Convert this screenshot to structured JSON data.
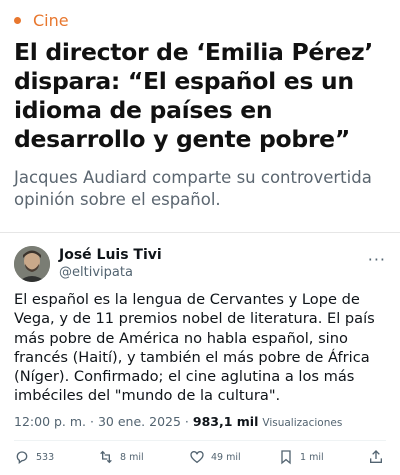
{
  "article": {
    "category": "Cine",
    "headline": "El director de ‘Emilia Pérez’ dispara: “El español es un idioma de países en desarrollo y gente pobre”",
    "subheadline": "Jacques Audiard comparte su controvertida opinión sobre el español."
  },
  "tweet": {
    "display_name": "José Luis Tivi",
    "handle": "@eltivipata",
    "text": "El español es la lengua de Cervantes y Lope de Vega, y de 11 premios nobel de literatura. El país más pobre de América no habla español, sino francés (Haití), y también el más pobre de África (Níger). Confirmado; el cine aglutina a los más imbéciles del \"mundo de la cultura\".",
    "time": "12:00 p. m.",
    "separator": "·",
    "date": "30 ene. 2025",
    "views_count": "983,1 mil",
    "views_label": "Visualizaciones",
    "more_glyph": "···"
  },
  "actions": {
    "replies": "533",
    "reposts": "8 mil",
    "likes": "49 mil",
    "bookmarks": "1 mil"
  },
  "colors": {
    "accent": "#e8772e",
    "secondary_text": "#536471"
  },
  "icons": [
    "reply-icon",
    "repost-icon",
    "like-icon",
    "bookmark-icon",
    "share-icon",
    "more-icon"
  ]
}
